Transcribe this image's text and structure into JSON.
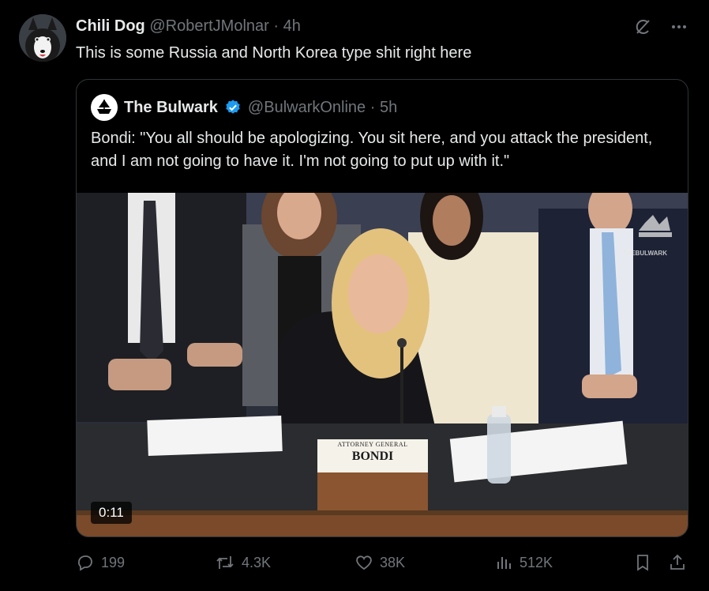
{
  "tweet": {
    "author_name": "Chili Dog",
    "handle": "@RobertJMolnar",
    "separator": " · ",
    "time": "4h",
    "text": "This is some Russia and North Korea type shit right here"
  },
  "quote": {
    "author_name": "The Bulwark",
    "handle": "@BulwarkOnline",
    "separator": " · ",
    "time": "5h",
    "text": "Bondi: \"You all should be apologizing. You sit here, and you attack the president, and I am not going to have it. I'm not going to put up with it.\"",
    "video": {
      "duration": "0:11",
      "watermark": "THEBULWARK",
      "nameplate_title": "ATTORNEY GENERAL",
      "nameplate_name": "BONDI"
    }
  },
  "metrics": {
    "replies": "199",
    "reposts": "4.3K",
    "likes": "38K",
    "views": "512K"
  },
  "colors": {
    "background": "#000000",
    "text": "#e7e9ea",
    "muted": "#71767b",
    "border": "#2f3336",
    "verified": "#1d9bf0"
  },
  "icons": [
    "grok-icon",
    "more-icon",
    "verified-icon",
    "reply-icon",
    "repost-icon",
    "like-icon",
    "views-icon",
    "bookmark-icon",
    "share-icon"
  ]
}
